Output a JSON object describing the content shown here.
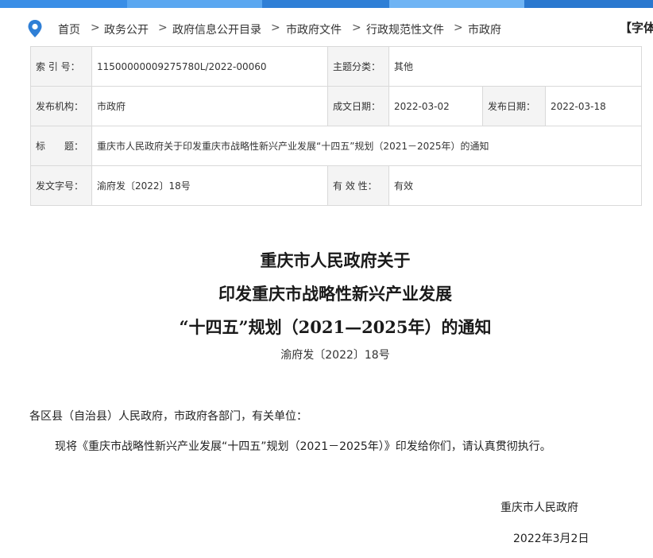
{
  "topbar": {
    "colors": [
      "#3a8ee6",
      "#5aa7f0",
      "#2f7fd6",
      "#6fb4f4",
      "#2a78cf"
    ]
  },
  "breadcrumb": {
    "icon": "location-pin-icon",
    "items": [
      "首页",
      "政务公开",
      "政府信息公开目录",
      "市政府文件",
      "行政规范性文件",
      "市政府"
    ],
    "separator": ">"
  },
  "font_tool": {
    "label": "【字体"
  },
  "meta": {
    "index_label": "索 引 号：",
    "index_value": "11500000009275780L/2022-00060",
    "category_label": "主题分类：",
    "category_value": "其他",
    "issuer_label": "发布机构：",
    "issuer_value": "市政府",
    "created_label": "成文日期：",
    "created_value": "2022-03-02",
    "published_label": "发布日期：",
    "published_value": "2022-03-18",
    "title_label": "标　　题：",
    "title_value": "重庆市人民政府关于印发重庆市战略性新兴产业发展“十四五”规划（2021－2025年）的通知",
    "docno_label": "发文字号：",
    "docno_value": "渝府发〔2022〕18号",
    "validity_label": "有 效 性：",
    "validity_value": "有效"
  },
  "document": {
    "title_lines": [
      "重庆市人民政府关于",
      "印发重庆市战略性新兴产业发展",
      "“十四五”规划（2021—2025年）的通知"
    ],
    "doc_number": "渝府发〔2022〕18号",
    "salutation": "各区县（自治县）人民政府，市政府各部门，有关单位：",
    "body": "现将《重庆市战略性新兴产业发展“十四五”规划（2021－2025年）》印发给你们，请认真贯彻执行。",
    "signer": "重庆市人民政府",
    "date": "2022年3月2日"
  }
}
